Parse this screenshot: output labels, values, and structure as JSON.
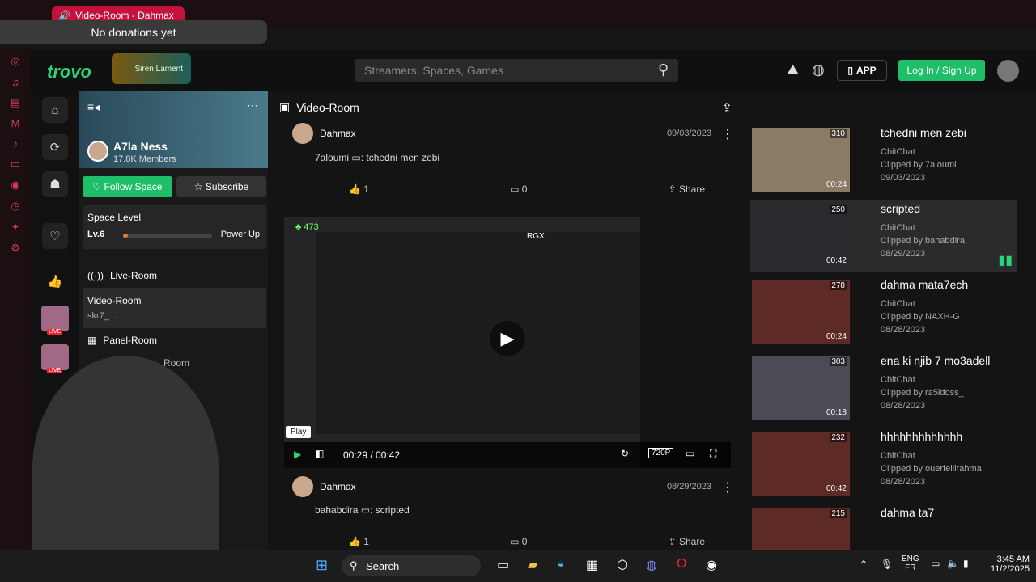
{
  "browser": {
    "tab_title": "Video-Room - Dahmax",
    "donation": "No donations yet"
  },
  "header": {
    "search_placeholder": "Streamers, Spaces, Games",
    "app_label": "APP",
    "login_label": "Log In / Sign Up",
    "logo_text": "trovo",
    "badge_text": "Siren Lament"
  },
  "space": {
    "name": "A7la Ness",
    "members": "17.8K Members",
    "follow_label": "Follow Space",
    "subscribe_label": "Subscribe",
    "level_title": "Space Level",
    "level": "Lv.6",
    "power_up": "Power Up",
    "progress": 0.05
  },
  "rooms": [
    {
      "label": "Live-Room"
    },
    {
      "label": "Video-Room",
      "sub": "skr7_ ..."
    },
    {
      "label": "Panel-Room"
    },
    {
      "label": "Room"
    }
  ],
  "content": {
    "title": "Video-Room"
  },
  "posts": [
    {
      "author": "Dahmax",
      "date": "09/03/2023",
      "clipper": "7aloumi",
      "clip_title": "tchedni men zebi",
      "likes": "1",
      "comments": "0",
      "share": "Share"
    },
    {
      "author": "Dahmax",
      "date": "08/29/2023",
      "clipper": "bahabdira",
      "clip_title": "scripted",
      "likes": "1",
      "comments": "0",
      "share": "Share"
    }
  ],
  "player": {
    "time": "00:29 / 00:42",
    "quality": "720P",
    "tooltip": "Play",
    "view_count": "473",
    "overlay_label": "RGX"
  },
  "clips": [
    {
      "title": "tchedni men zebi",
      "category": "ChitChat",
      "clipped_by": "Clipped by 7aloumi",
      "date": "09/03/2023",
      "views": "310",
      "duration": "00:24"
    },
    {
      "title": "scripted",
      "category": "ChitChat",
      "clipped_by": "Clipped by bahabdira",
      "date": "08/29/2023",
      "views": "250",
      "duration": "00:42"
    },
    {
      "title": "dahma mata7ech",
      "category": "ChitChat",
      "clipped_by": "Clipped by NAXH-G",
      "date": "08/28/2023",
      "views": "278",
      "duration": "00:24"
    },
    {
      "title": "ena ki njib 7 mo3adell",
      "category": "ChitChat",
      "clipped_by": "Clipped by ra5idoss_",
      "date": "08/28/2023",
      "views": "303",
      "duration": "00:18"
    },
    {
      "title": "hhhhhhhhhhhhh",
      "category": "ChitChat",
      "clipped_by": "Clipped by ouerfellirahma",
      "date": "08/28/2023",
      "views": "232",
      "duration": "00:42"
    },
    {
      "title": "dahma ta7",
      "views": "215"
    }
  ],
  "taskbar": {
    "search": "Search",
    "lang1": "ENG",
    "lang2": "FR",
    "time": "3:45 AM",
    "date": "11/2/2025"
  }
}
